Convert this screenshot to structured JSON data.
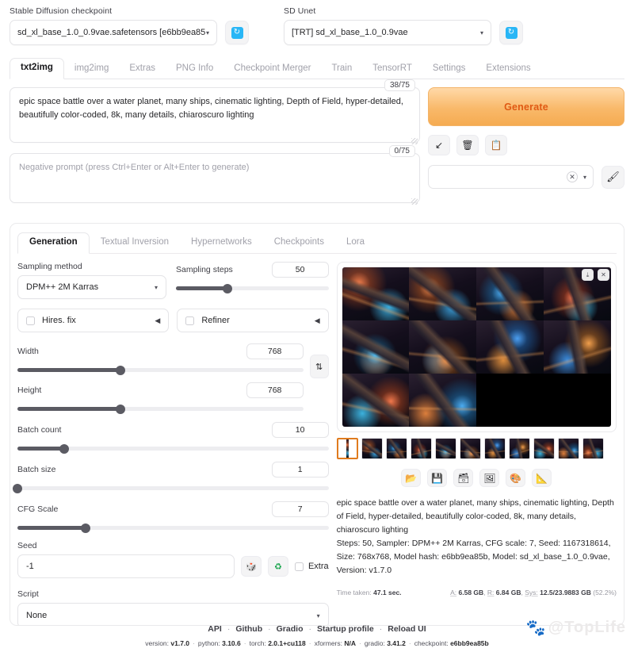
{
  "top": {
    "checkpoint_label": "Stable Diffusion checkpoint",
    "checkpoint_value": "sd_xl_base_1.0_0.9vae.safetensors [e6bb9ea85",
    "unet_label": "SD Unet",
    "unet_value": "[TRT] sd_xl_base_1.0_0.9vae",
    "refresh_glyph": "↻",
    "caret": "▾"
  },
  "main_tabs": [
    {
      "label": "txt2img",
      "active": true
    },
    {
      "label": "img2img",
      "active": false
    },
    {
      "label": "Extras",
      "active": false
    },
    {
      "label": "PNG Info",
      "active": false
    },
    {
      "label": "Checkpoint Merger",
      "active": false
    },
    {
      "label": "Train",
      "active": false
    },
    {
      "label": "TensorRT",
      "active": false
    },
    {
      "label": "Settings",
      "active": false
    },
    {
      "label": "Extensions",
      "active": false
    }
  ],
  "prompt": {
    "positive_value": "epic space battle over a water planet, many ships, cinematic lighting, Depth of Field, hyper-detailed, beautifully color-coded, 8k, many details, chiaroscuro lighting",
    "positive_counter": "38/75",
    "negative_placeholder": "Negative prompt (press Ctrl+Enter or Alt+Enter to generate)",
    "negative_value": "",
    "negative_counter": "0/75"
  },
  "generate": {
    "label": "Generate",
    "buttons": [
      {
        "name": "arrow-down-left-icon",
        "glyph": "↙"
      },
      {
        "name": "trash-icon",
        "glyph": "🗑"
      },
      {
        "name": "clipboard-icon",
        "glyph": "📋"
      }
    ],
    "styles_value": "",
    "clear_glyph": "✕",
    "caret": "▾",
    "brush_glyph": "🖌"
  },
  "sub_tabs": [
    {
      "label": "Generation",
      "active": true
    },
    {
      "label": "Textual Inversion",
      "active": false
    },
    {
      "label": "Hypernetworks",
      "active": false
    },
    {
      "label": "Checkpoints",
      "active": false
    },
    {
      "label": "Lora",
      "active": false
    }
  ],
  "settings": {
    "sampling_method_label": "Sampling method",
    "sampling_method_value": "DPM++ 2M Karras",
    "sampling_steps_label": "Sampling steps",
    "sampling_steps_value": "50",
    "sampling_steps_pct": 34,
    "hires_fix_label": "Hires. fix",
    "refiner_label": "Refiner",
    "triangle": "◀",
    "width_label": "Width",
    "width_value": "768",
    "width_pct": 36,
    "height_label": "Height",
    "height_value": "768",
    "height_pct": 36,
    "swap_glyph": "⇅",
    "batch_count_label": "Batch count",
    "batch_count_value": "10",
    "batch_count_pct": 15,
    "batch_size_label": "Batch size",
    "batch_size_value": "1",
    "batch_size_pct": 0,
    "cfg_label": "CFG Scale",
    "cfg_value": "7",
    "cfg_pct": 22,
    "seed_label": "Seed",
    "seed_value": "-1",
    "seed_dice_glyph": "🎲",
    "seed_recycle_glyph": "♻",
    "extra_label": "Extra",
    "script_label": "Script",
    "script_value": "None",
    "caret": "▾"
  },
  "gallery": {
    "download_glyph": "⤓",
    "close_glyph": "✕",
    "tile_count": 10,
    "thumb_count": 11,
    "selected_thumb": 0,
    "action_buttons": [
      {
        "name": "open-folder-icon",
        "glyph": "📂"
      },
      {
        "name": "save-icon",
        "glyph": "💾"
      },
      {
        "name": "save-zip-icon",
        "glyph": "🗃"
      },
      {
        "name": "send-to-img2img-icon",
        "glyph": "🖼"
      },
      {
        "name": "send-to-inpaint-icon",
        "glyph": "🎨"
      },
      {
        "name": "send-to-extras-icon",
        "glyph": "📐"
      }
    ]
  },
  "info": {
    "prompt_text": "epic space battle over a water planet, many ships, cinematic lighting, Depth of Field, hyper-detailed, beautifully color-coded, 8k, many details, chiaroscuro lighting",
    "params_text": "Steps: 50, Sampler: DPM++ 2M Karras, CFG scale: 7, Seed: 1167318614, Size: 768x768, Model hash: e6bb9ea85b, Model: sd_xl_base_1.0_0.9vae, Version: v1.7.0",
    "time_taken_label": "Time taken:",
    "time_taken_value": "47.1 sec.",
    "mem_a_label": "A:",
    "mem_a_value": "6.58 GB",
    "mem_r_label": "R:",
    "mem_r_value": "6.84 GB",
    "mem_sys_label": "Sys:",
    "mem_sys_value": "12.5/23.9883 GB",
    "mem_sys_pct": "(52.2%)"
  },
  "footer": {
    "links": [
      "API",
      "Github",
      "Gradio",
      "Startup profile",
      "Reload UI"
    ],
    "version_label": "version:",
    "version_value": "v1.7.0",
    "python_label": "python:",
    "python_value": "3.10.6",
    "torch_label": "torch:",
    "torch_value": "2.0.1+cu118",
    "xformers_label": "xformers:",
    "xformers_value": "N/A",
    "gradio_label": "gradio:",
    "gradio_value": "3.41.2",
    "checkpoint_label": "checkpoint:",
    "checkpoint_value": "e6bb9ea85b",
    "watermark": "@TopLife"
  }
}
